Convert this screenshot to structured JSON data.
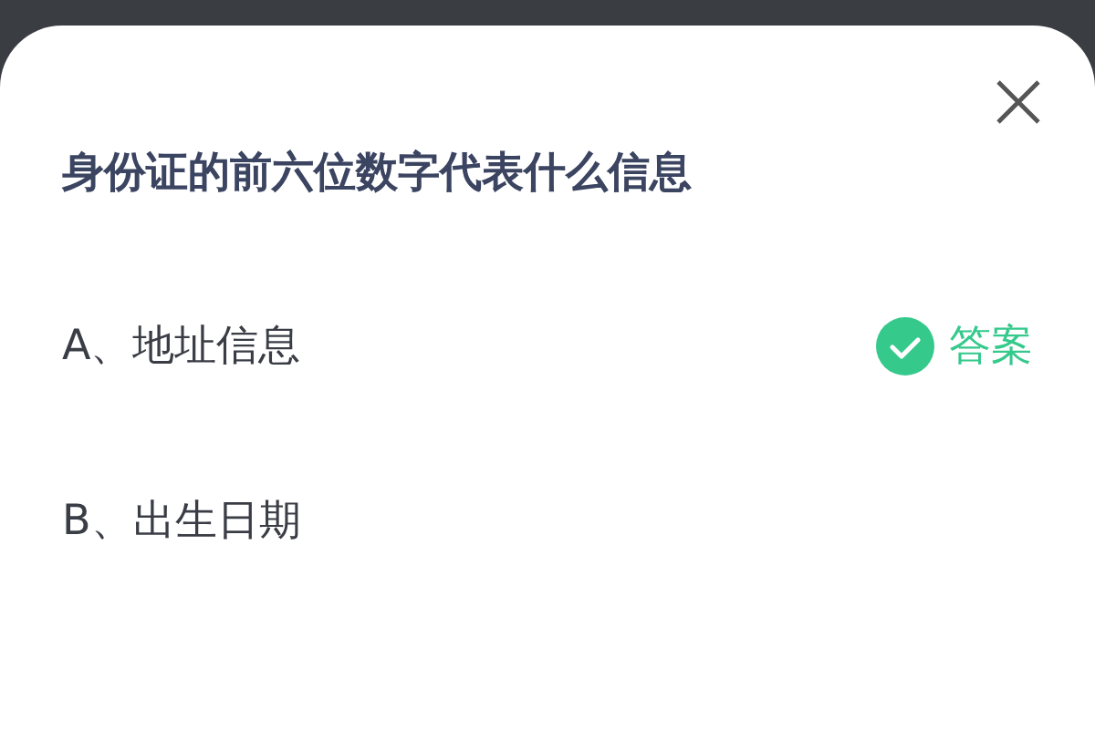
{
  "question": "身份证的前六位数字代表什么信息",
  "options": [
    {
      "text": "A、地址信息",
      "correct": true,
      "answer_label": "答案"
    },
    {
      "text": "B、出生日期",
      "correct": false
    }
  ]
}
